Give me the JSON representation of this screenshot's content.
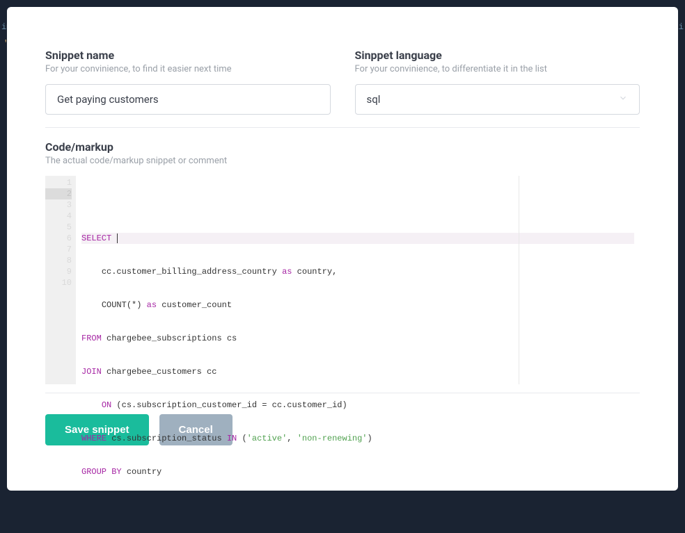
{
  "background": {
    "left_fragment": "im",
    "right_fragment": "_li",
    "quote_fragment": "\""
  },
  "fields": {
    "name": {
      "label": "Snippet name",
      "hint": "For your convinience, to find it easier next time",
      "value": "Get paying customers"
    },
    "language": {
      "label": "Sinppet language",
      "hint": "For your convinience, to differentiate it in the list",
      "value": "sql"
    },
    "code": {
      "label": "Code/markup",
      "hint": "The actual code/markup snippet or comment"
    }
  },
  "editor": {
    "line_numbers": [
      "1",
      "2",
      "3",
      "4",
      "5",
      "6",
      "7",
      "8",
      "9",
      "10"
    ],
    "active_line": 2,
    "tokens": {
      "select": "SELECT",
      "l3_ident": "cc.customer_billing_address_country",
      "as": "as",
      "l3_alias": "country,",
      "count": "COUNT",
      "star": "(*)",
      "l4_alias": "customer_count",
      "from": "FROM",
      "l5_rest": "chargebee_subscriptions cs",
      "join": "JOIN",
      "l6_rest": "chargebee_customers cc",
      "on": "ON",
      "l7_rest": "(cs.subscription_customer_id = cc.customer_id)",
      "where": "WHERE",
      "l8_mid": "cs.subscription_status",
      "in": "IN",
      "l8_paren_open": "(",
      "l8_str1": "'active'",
      "l8_comma": ",",
      "l8_str2": "'non-renewing'",
      "l8_paren_close": ")",
      "group_by": "GROUP BY",
      "l9_rest": "country"
    }
  },
  "buttons": {
    "save": "Save snippet",
    "cancel": "Cancel"
  }
}
